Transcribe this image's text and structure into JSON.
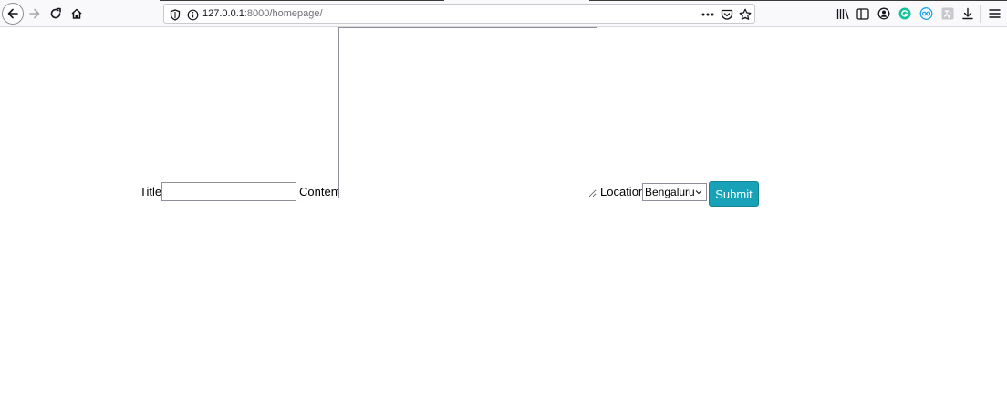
{
  "browser": {
    "url_host": "127.0.0.1",
    "url_path": ":8000/homepage/",
    "icons": {
      "back": "arrow-left-icon",
      "forward": "arrow-right-icon",
      "reload": "reload-icon",
      "home": "home-icon",
      "shield": "shield-icon",
      "site_info": "info-icon",
      "page_actions": "more-dots-icon",
      "pocket": "pocket-icon",
      "bookmark": "star-icon",
      "library": "library-icon",
      "sidebar": "sidebar-icon",
      "account": "account-icon",
      "ext_grammarly": "grammarly-icon",
      "ext_cc": "cc-icon",
      "ext_translate": "translate-icon",
      "downloads": "download-icon",
      "menu": "hamburger-menu-icon"
    },
    "colors": {
      "grammarly": "#15c39a",
      "cc": "#1aa3e8"
    }
  },
  "form": {
    "title_label": "Title:",
    "title_value": "",
    "content_label": "Content:",
    "content_value": "",
    "location_label": "Location:",
    "location_selected": "Bengaluru",
    "submit_label": "Submit",
    "submit_color": "#17a2b8"
  }
}
